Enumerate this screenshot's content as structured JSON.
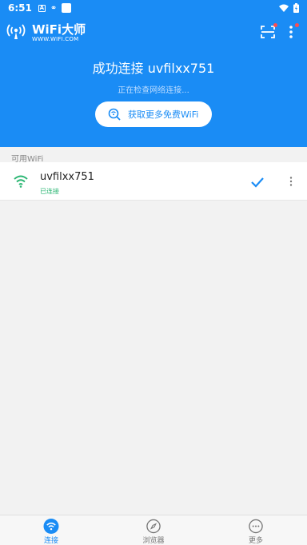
{
  "status_bar": {
    "time": "6:51",
    "icons": [
      "a-badge-icon",
      "link-icon",
      "blank-square-icon"
    ],
    "right_icons": [
      "wifi-signal-icon",
      "battery-icon"
    ]
  },
  "app": {
    "title": "WiFi大师",
    "subtitle": "WWW.WIFI.COM",
    "icons": [
      "wifi-master-logo-icon",
      "scan-icon",
      "more-vertical-icon"
    ]
  },
  "connection": {
    "title": "成功连接 uvfilxx751",
    "status": "正在检查网络连接...",
    "button_label": "获取更多免费WiFi"
  },
  "available": {
    "section_label": "可用WiFi",
    "networks": [
      {
        "name": "uvfilxx751",
        "status": "已连接",
        "connected": true
      }
    ]
  },
  "bottom_nav": [
    {
      "label": "连接",
      "icon": "wifi-icon",
      "active": true
    },
    {
      "label": "浏览器",
      "icon": "compass-icon",
      "active": false
    },
    {
      "label": "更多",
      "icon": "more-horizontal-icon",
      "active": false
    }
  ],
  "colors": {
    "primary": "#1a8cf5",
    "connected_green": "#2bb673",
    "notification_red": "#ff4d4f",
    "background": "#f2f2f2"
  }
}
